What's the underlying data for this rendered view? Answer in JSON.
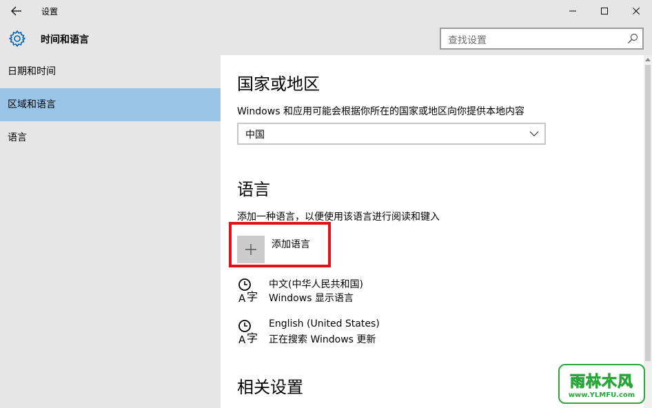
{
  "window": {
    "app_title": "设置",
    "page_title": "时间和语言"
  },
  "search": {
    "placeholder": "查找设置"
  },
  "sidebar": {
    "items": [
      {
        "label": "日期和时间",
        "selected": false
      },
      {
        "label": "区域和语言",
        "selected": true
      },
      {
        "label": "语言",
        "selected": false
      }
    ]
  },
  "region": {
    "heading": "国家或地区",
    "description": "Windows 和应用可能会根据你所在的国家或地区向你提供本地内容",
    "selected_value": "中国"
  },
  "language": {
    "heading": "语言",
    "description": "添加一种语言，以便使用该语言进行阅读和键入",
    "add_label": "添加语言",
    "items": [
      {
        "name": "中文(中华人民共和国)",
        "status": "Windows 显示语言"
      },
      {
        "name": "English (United States)",
        "status": "正在搜索 Windows 更新"
      }
    ]
  },
  "related": {
    "heading": "相关设置"
  },
  "watermark": {
    "brand": "雨林木风",
    "url": "www.YLMFU.com"
  },
  "colors": {
    "sidebar_bg": "#e6e6e6",
    "selected_bg": "#99c4e8",
    "highlight_border": "#e2101a",
    "accent": "#0063b1"
  }
}
